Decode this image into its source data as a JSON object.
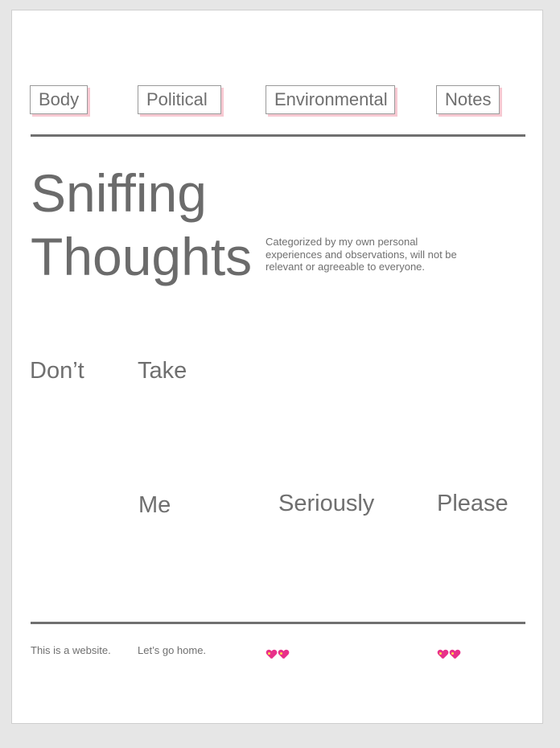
{
  "nav": {
    "items": [
      {
        "label": "Body"
      },
      {
        "label": "Political"
      },
      {
        "label": "Environmental"
      },
      {
        "label": "Notes"
      }
    ]
  },
  "hero": {
    "title_line1": "Sniffing",
    "title_line2": "Thoughts",
    "description": "Categorized by my own personal experiences and observations, will not be relevant or agreeable to everyone."
  },
  "words": {
    "w1": "Don’t",
    "w2": "Take",
    "w3": "Me",
    "w4": "Seriously",
    "w5": "Please"
  },
  "footer": {
    "text1": "This is a website.",
    "text2": "Let’s go home.",
    "emoji_icon": "sparkling-heart-icon",
    "heart_color": "#e8308a"
  }
}
